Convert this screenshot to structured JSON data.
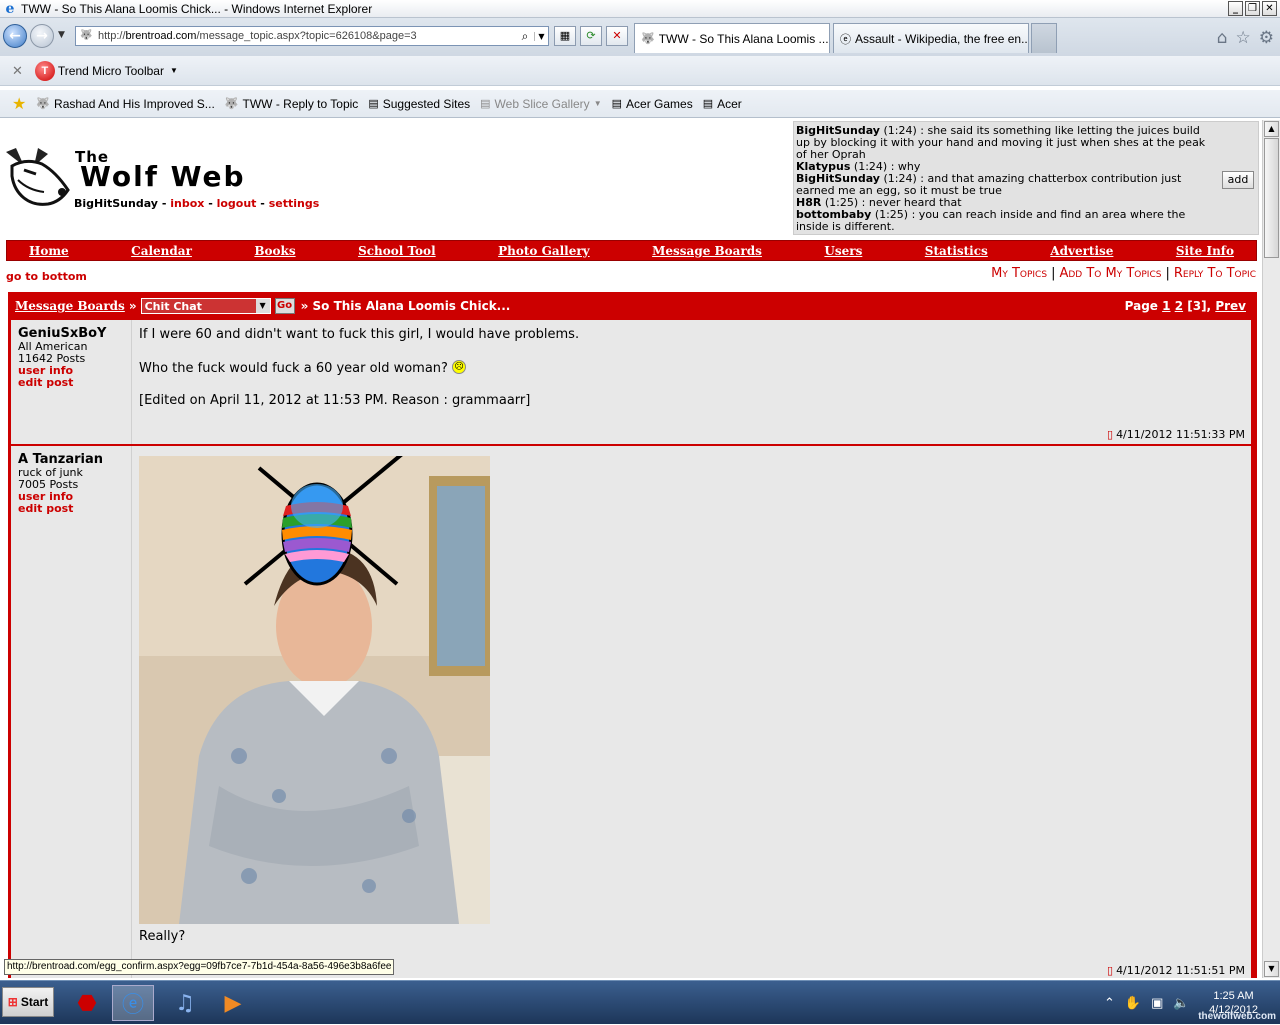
{
  "window": {
    "title": "TWW - So This Alana Loomis Chick... - Windows Internet Explorer"
  },
  "browser": {
    "url_prefix": "http://",
    "url_domain": "brentroad.com",
    "url_path": "/message_topic.aspx?topic=626108&page=3",
    "tabs": [
      {
        "label": "TWW - So This Alana Loomis ...",
        "active": true
      },
      {
        "label": "Assault - Wikipedia, the free en...",
        "active": false
      }
    ]
  },
  "toolbar": {
    "trend_micro": "Trend Micro Toolbar"
  },
  "favorites": [
    {
      "label": "Rashad And His Improved S...",
      "gray": false
    },
    {
      "label": "TWW - Reply to Topic",
      "gray": false
    },
    {
      "label": "Suggested Sites",
      "gray": false
    },
    {
      "label": "Web Slice Gallery",
      "gray": true
    },
    {
      "label": "Acer Games",
      "gray": false
    },
    {
      "label": "Acer",
      "gray": false
    }
  ],
  "site": {
    "brand_the": "The",
    "brand_name": "Wolf Web",
    "username": "BigHitSunday",
    "inbox": "inbox",
    "logout": "logout",
    "settings": "settings",
    "sep": " - "
  },
  "chatbox": {
    "add_label": "add",
    "messages": [
      {
        "user": "BigHitSunday",
        "time": "(1:24)",
        "text": ": she said its something like letting the juices build up by blocking it with your hand and moving it just when shes at the peak of her Oprah"
      },
      {
        "user": "Klatypus",
        "time": "(1:24)",
        "text": ": why"
      },
      {
        "user": "BigHitSunday",
        "time": "(1:24)",
        "text": ": and that amazing chatterbox contribution just earned me an egg, so it must be true"
      },
      {
        "user": "H8R",
        "time": "(1:25)",
        "text": ": never heard that"
      },
      {
        "user": "bottombaby",
        "time": "(1:25)",
        "text": ": you can reach inside and find an area where the inside is different."
      }
    ]
  },
  "nav": [
    "Home",
    "Calendar",
    "Books",
    "School Tool",
    "Photo Gallery",
    "Message Boards",
    "Users",
    "Statistics",
    "Advertise",
    "Site Info"
  ],
  "topic_links": {
    "go_to_bottom": "go to bottom",
    "my_topics": "My Topics",
    "add_to_my_topics": "Add To My Topics",
    "reply_to_topic": "Reply To Topic",
    "sep": "|"
  },
  "board": {
    "message_boards": "Message Boards",
    "arrow": "»",
    "selected_board": "Chit Chat",
    "go": "Go",
    "topic_title": "» So This Alana Loomis Chick...",
    "page_prefix": "Page",
    "page_1": "1",
    "page_2": "2",
    "page_3": "[3],",
    "prev": "Prev"
  },
  "posts": [
    {
      "author": "GeniuSxBoY",
      "rank": "All American",
      "posts": "11642 Posts",
      "user_info": "user info",
      "edit_post": "edit post",
      "line1": "If I were 60 and didn't want to fuck this girl, I would have problems.",
      "line2": "Who the fuck would fuck a 60 year old woman?",
      "line3": "[Edited on April 11, 2012 at 11:53 PM. Reason : grammaarr]",
      "timestamp": "4/11/2012 11:51:33 PM"
    },
    {
      "author": "A Tanzarian",
      "rank": "ruck of junk",
      "posts": "7005 Posts",
      "user_info": "user info",
      "edit_post": "edit post",
      "line1": "Really?",
      "timestamp": "4/11/2012 11:51:51 PM"
    }
  ],
  "status_url": "http://brentroad.com/egg_confirm.aspx?egg=09fb7ce7-7b1d-454a-8a56-496e3b8a6fee",
  "taskbar": {
    "start": "Start",
    "time": "1:25 AM",
    "date": "4/12/2012",
    "watermark": "thewolfweb.com"
  }
}
